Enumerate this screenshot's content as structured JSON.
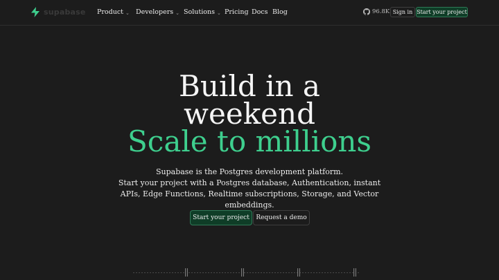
{
  "brand": {
    "name": "supabase",
    "color": "#3ecf8e"
  },
  "nav": {
    "items": [
      {
        "label": "Product",
        "dropdown": true
      },
      {
        "label": "Developers",
        "dropdown": true
      },
      {
        "label": "Solutions",
        "dropdown": true
      },
      {
        "label": "Pricing",
        "dropdown": false
      },
      {
        "label": "Docs",
        "dropdown": false
      },
      {
        "label": "Blog",
        "dropdown": false
      }
    ],
    "github_stars": "96.8K",
    "signin_label": "Sign in",
    "start_label": "Start your project"
  },
  "hero": {
    "title_line1": "Build in a",
    "title_line2": "weekend",
    "title_line3": "Scale to millions",
    "description_line1": "Supabase is the Postgres development platform.",
    "description_line2": "Start your project with a Postgres database, Authentication, instant APIs, Edge Functions, Realtime subscriptions, Storage, and Vector embeddings.",
    "primary_cta": "Start your project",
    "secondary_cta": "Request a demo"
  },
  "icons": {
    "logo": "supabase-bolt-icon",
    "github": "github-icon",
    "dropdown": "chevron-down-icon"
  }
}
